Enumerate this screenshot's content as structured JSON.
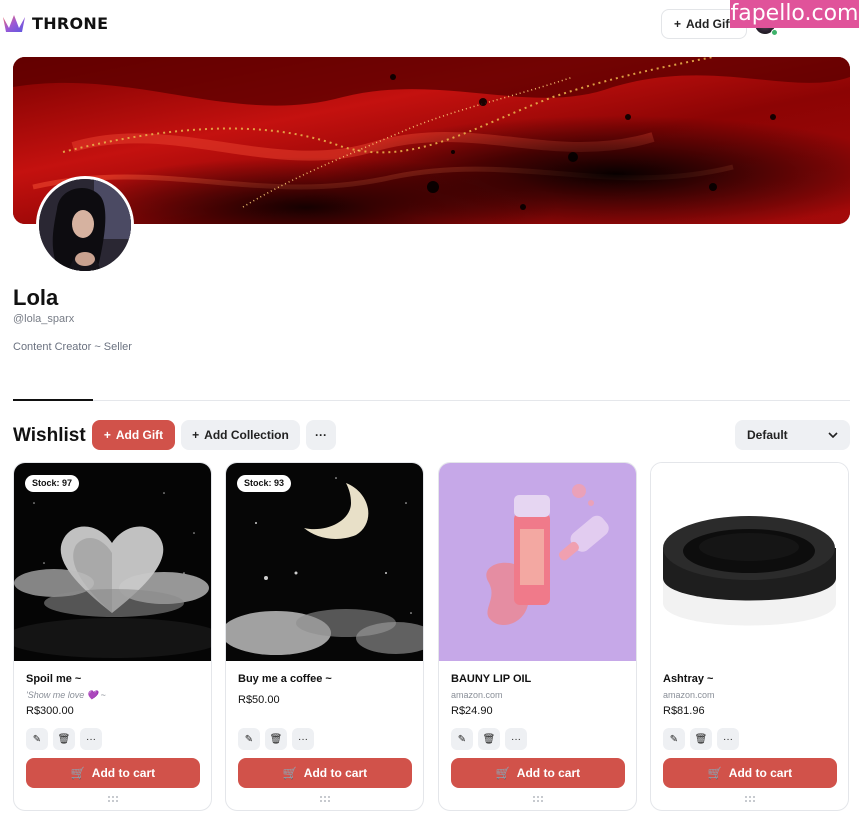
{
  "header": {
    "logo_text": "THRONE",
    "add_gift_label": "Add Gift",
    "watermark": "fapello.com"
  },
  "profile": {
    "name": "Lola",
    "handle": "@lola_sparx",
    "bio": "Content Creator ~ Seller"
  },
  "wishlist": {
    "title": "Wishlist",
    "add_gift_label": "Add Gift",
    "add_collection_label": "Add Collection",
    "more_label": "···",
    "sort_selected": "Default"
  },
  "cards": [
    {
      "stock": "Stock: 97",
      "title": "Spoil me ~",
      "subtitle": "'Show me love 💜 ~",
      "price": "R$300.00",
      "cart_label": "Add to cart"
    },
    {
      "stock": "Stock: 93",
      "title": "Buy me a coffee ~",
      "subtitle": "",
      "price": "R$50.00",
      "cart_label": "Add to cart"
    },
    {
      "stock": "",
      "title": "BAUNY LIP OIL",
      "subtitle": "amazon.com",
      "price": "R$24.90",
      "cart_label": "Add to cart"
    },
    {
      "stock": "",
      "title": "Ashtray ~",
      "subtitle": "amazon.com",
      "price": "R$81.96",
      "cart_label": "Add to cart"
    }
  ],
  "colors": {
    "accent": "#d1524a",
    "button_grey": "#eef0f3",
    "watermark": "#e0539a",
    "online": "#3db26a"
  }
}
